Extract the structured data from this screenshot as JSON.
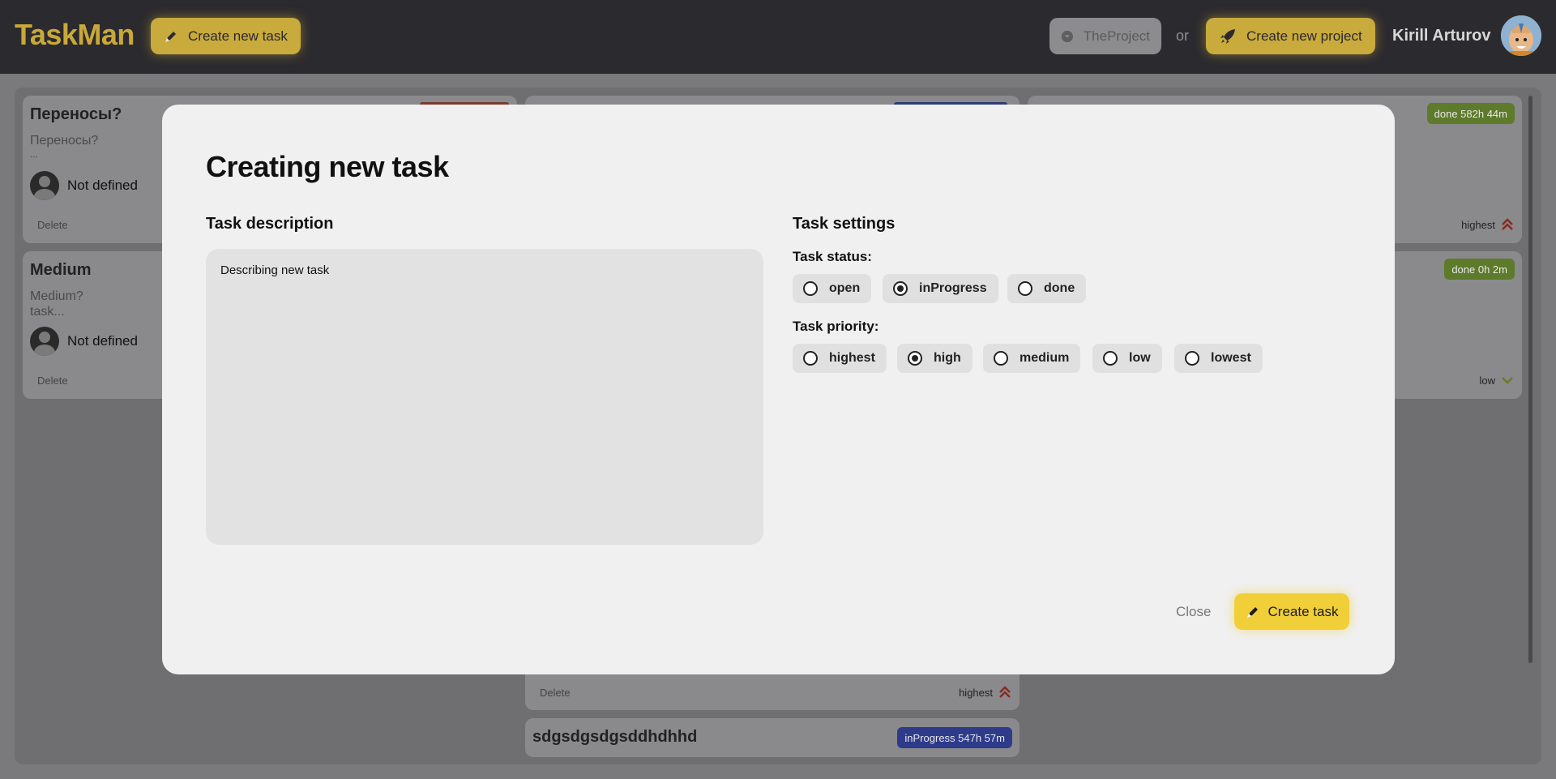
{
  "app": {
    "logo": "TaskMan",
    "create_task_label": "Create new task",
    "project_name": "TheProject",
    "or_text": "or",
    "create_project_label": "Create new project",
    "user_name": "Kirill Arturov"
  },
  "board": {
    "cards": [
      {
        "title": "Переносы?",
        "text_line1": "Переносы?",
        "text_line2": "...",
        "user": "Not defined",
        "delete": "Delete"
      },
      {
        "title": "Medium",
        "text_line1": "Medium?",
        "text_line2": "task...",
        "user": "Not defined",
        "delete": "Delete"
      },
      {
        "badge": "done 582h 44m",
        "priority": "highest"
      },
      {
        "badge": "done 0h 2m",
        "priority": "low"
      },
      {
        "delete": "Delete",
        "priority": "highest"
      },
      {
        "title": "sdgsdgsdgsddhdhhd",
        "badge": "inProgress 547h 57m"
      }
    ]
  },
  "modal": {
    "title": "Creating new task",
    "description_heading": "Task description",
    "description_value": "Describing new task",
    "settings_heading": "Task settings",
    "status_label": "Task status:",
    "status_options": [
      "open",
      "inProgress",
      "done"
    ],
    "status_selected": "inProgress",
    "priority_label": "Task priority:",
    "priority_options": [
      "highest",
      "high",
      "medium",
      "low",
      "lowest"
    ],
    "priority_selected": "high",
    "close_label": "Close",
    "create_label": "Create task"
  },
  "colors": {
    "accent": "#f0cf38",
    "done_badge": "#5e7a2b",
    "inprogress_badge": "#3246a0",
    "highest_arrow": "#c0392b",
    "low_arrow": "#8fa33a"
  }
}
